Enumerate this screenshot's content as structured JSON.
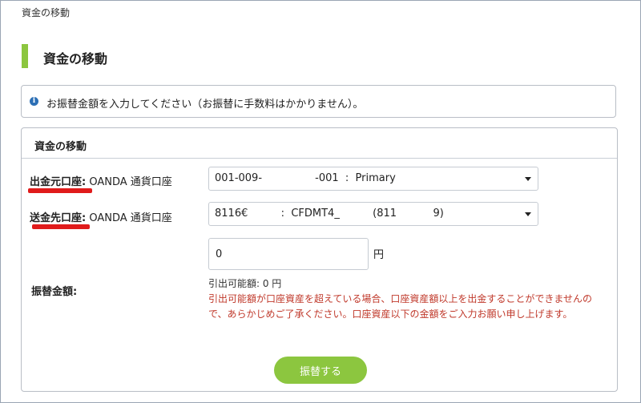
{
  "breadcrumb": "資金の移動",
  "page_title": "資金の移動",
  "info": {
    "icon": "info-circle-icon",
    "text": "お振替金額を入力してください（お振替に手数料はかかりません）。"
  },
  "panel": {
    "title": "資金の移動",
    "from": {
      "label": "出金元口座:",
      "account_type": " OANDA 通貨口座",
      "selected": "001-009-                -001  :  Primary"
    },
    "to": {
      "label": "送金先口座:",
      "account_type": " OANDA 通貨口座",
      "selected": "8116€          :  CFDMT4_          (811           9)"
    },
    "amount": {
      "label": "振替金額:",
      "value": "0",
      "unit": "円",
      "available": "引出可能額: 0 円",
      "warning": "引出可能額が口座資産を超えている場合、口座資産額以上を出金することができませんので、あらかじめご了承ください。口座資産以下の金額をご入力お願い申し上げます。"
    },
    "submit_label": "振替する"
  },
  "colors": {
    "accent": "#8cc63f",
    "warning": "#c0392b",
    "highlight": "#e01b1b",
    "info_icon": "#2c6fb5"
  }
}
